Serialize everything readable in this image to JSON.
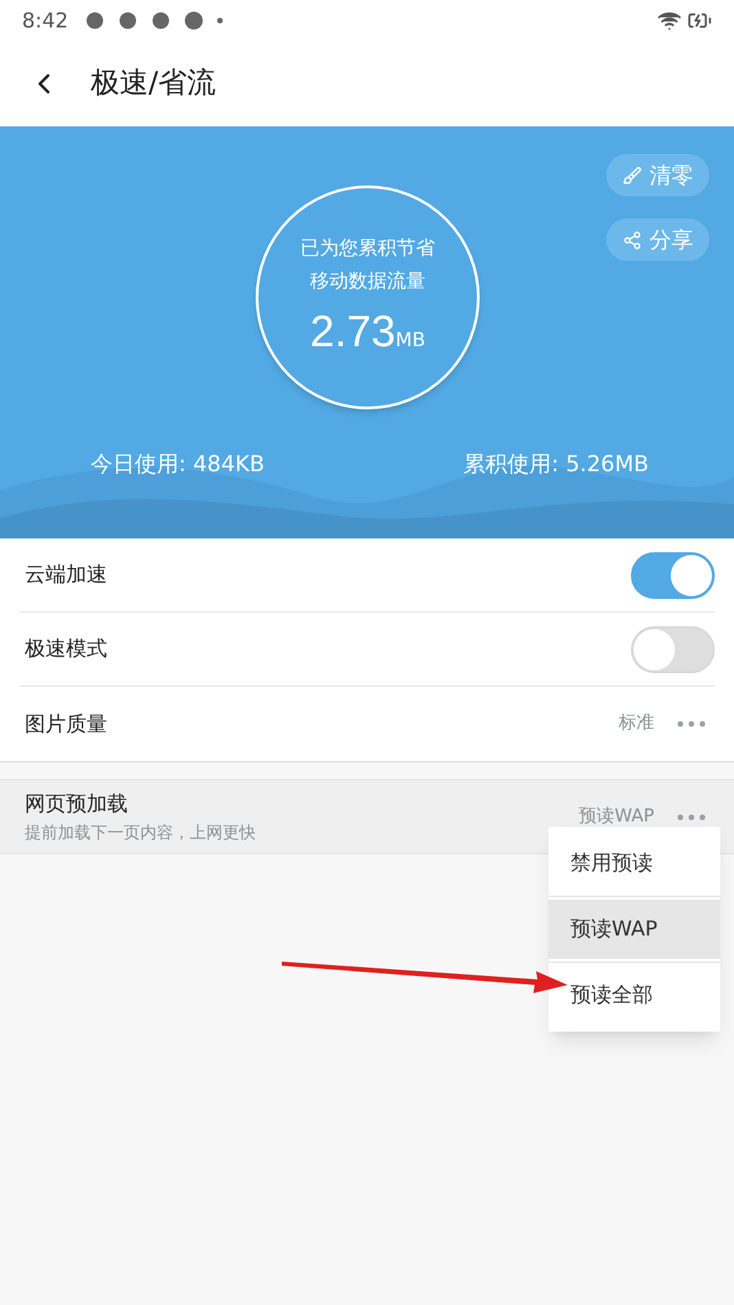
{
  "status_bar": {
    "time": "8:42"
  },
  "header": {
    "title": "极速/省流"
  },
  "summary": {
    "line1": "已为您累积节省",
    "line2": "移动数据流量",
    "value": "2.73",
    "unit": "MB",
    "today": "今日使用: 484KB",
    "total": "累积使用: 5.26MB",
    "actions": [
      {
        "kind": "clear",
        "label": "清零"
      },
      {
        "kind": "share",
        "label": "分享"
      }
    ]
  },
  "settings": [
    {
      "kind": "toggle",
      "label": "云端加速",
      "on": true
    },
    {
      "kind": "toggle",
      "label": "极速模式",
      "on": false
    },
    {
      "kind": "option",
      "label": "图片质量",
      "value": "标准"
    }
  ],
  "preload": {
    "label": "网页预加载",
    "description": "提前加载下一页内容，上网更快",
    "value": "预读WAP"
  },
  "menu": [
    {
      "label": "禁用预读",
      "selected": false
    },
    {
      "label": "预读WAP",
      "selected": true
    },
    {
      "label": "预读全部",
      "selected": false
    }
  ]
}
